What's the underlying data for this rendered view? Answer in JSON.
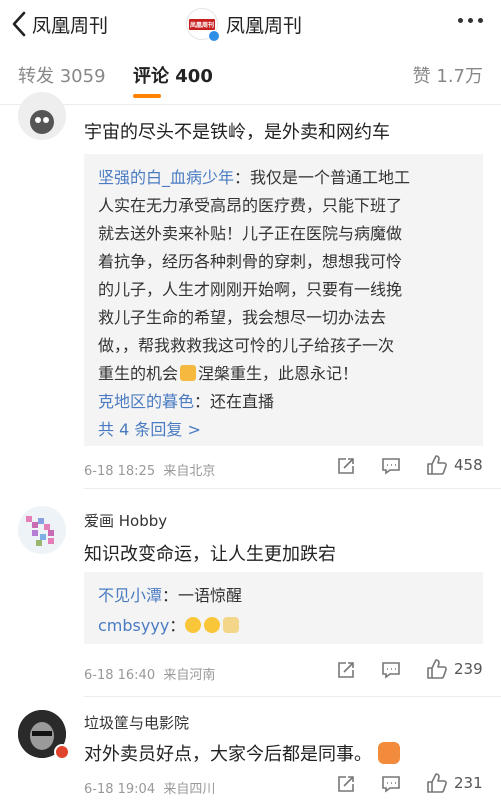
{
  "nav": {
    "back_label": "凤凰周刊",
    "title": "凤凰周刊",
    "logo_text": "凤凰周刊"
  },
  "tabs": {
    "repost": "转发 3059",
    "comments": "评论 400",
    "likes": "赞 1.7万"
  },
  "comments": [
    {
      "text": "宇宙的尽头不是铁岭，是外卖和网约车",
      "replies": [
        {
          "user": "坚强的白_血病少年",
          "lines": [
            "：我仅是一个普通工地工",
            "人实在无力承受高昂的医疗费，只能下班了",
            "就去送外卖来补贴！儿子正在医院与病魔做",
            "着抗争，经历各种刺骨的穿刺，想想我可怜",
            "的儿子，人生才刚刚开始啊，只要有一线挽",
            "救儿子生命的希望，我会想尽一切办法去",
            "做，，帮我救救我这可怜的儿子给孩子一次",
            "重生的机会",
            "涅槃重生，此恩永记！"
          ]
        },
        {
          "user": "克地区的暮色",
          "text": "：还在直播"
        }
      ],
      "more_replies": "共 4 条回复 >",
      "time": "6-18 18:25",
      "source": "来自北京",
      "likes": "458"
    },
    {
      "username": "爱画 Hobby",
      "text": "知识改变命运，让人生更加跌宕",
      "replies": [
        {
          "user": "不见小潭",
          "text": "：一语惊醒"
        },
        {
          "user": "cmbsyyy",
          "text": "："
        }
      ],
      "time": "6-18 16:40",
      "source": "来自河南",
      "likes": "239"
    },
    {
      "username": "垃圾筐与电影院",
      "text": "对外卖员好点，大家今后都是同事。",
      "time": "6-18 19:04",
      "source": "来自四川",
      "likes": "231"
    }
  ],
  "icons": {
    "back": "chevron-left-icon",
    "more": "more-dots-icon",
    "repost": "repost-icon",
    "comment": "comment-icon",
    "like": "thumbs-up-icon"
  },
  "colors": {
    "accent": "#ff8200",
    "link": "#4a7bc2",
    "reply_bg": "#f4f4f4",
    "meta": "#999999"
  }
}
